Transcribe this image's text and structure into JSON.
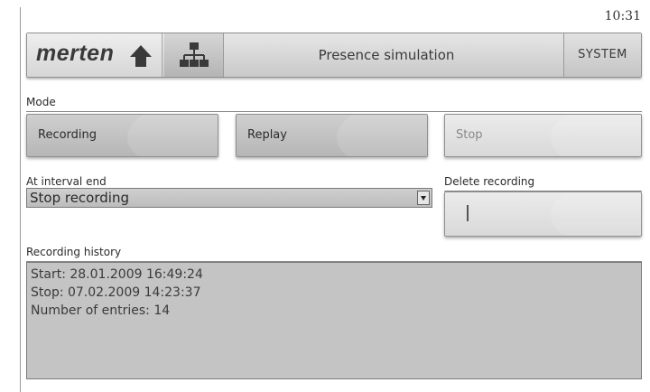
{
  "status": {
    "time": "10:31"
  },
  "header": {
    "brand": "merten",
    "title": "Presence simulation",
    "system_label": "SYSTEM"
  },
  "mode": {
    "label": "Mode",
    "recording_label": "Recording",
    "replay_label": "Replay",
    "stop_label": "Stop"
  },
  "interval": {
    "label": "At interval end",
    "selected": "Stop recording"
  },
  "delete": {
    "label": "Delete recording"
  },
  "history": {
    "label": "Recording history",
    "lines": [
      "Start: 28.01.2009 16:49:24",
      "Stop: 07.02.2009 14:23:37",
      "Number of entries: 14"
    ]
  },
  "icons": {
    "home": "home-icon",
    "network": "network-icon",
    "dropdown": "chevron-down-icon",
    "delete": "delete-icon"
  }
}
